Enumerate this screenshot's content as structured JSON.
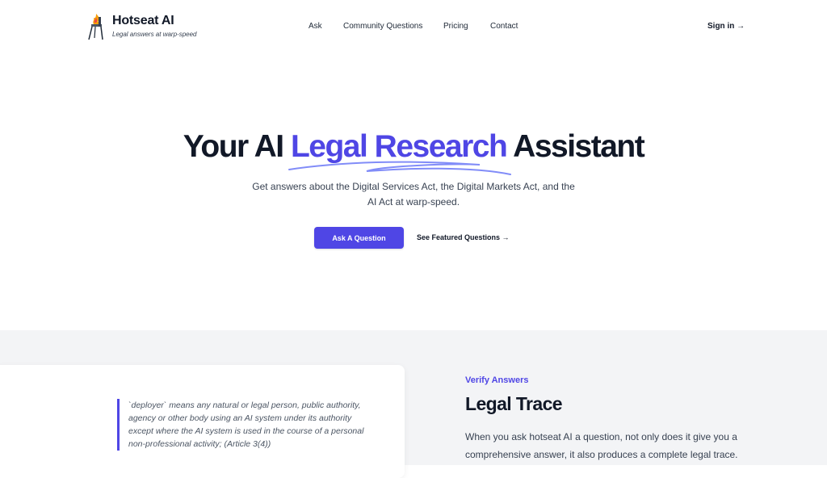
{
  "brand": {
    "name": "Hotseat AI",
    "tagline": "Legal answers at warp-speed"
  },
  "nav": {
    "items": [
      "Ask",
      "Community Questions",
      "Pricing",
      "Contact"
    ],
    "signin": "Sign in →"
  },
  "hero": {
    "title_pre": "Your AI ",
    "title_accent": "Legal Research",
    "title_post": " Assistant",
    "subtitle": "Get answers about the Digital Services Act, the Digital Markets Act, and the AI Act at warp-speed.",
    "primary_button": "Ask A Question",
    "secondary_link": "See Featured Questions →"
  },
  "feature": {
    "quote": "`deployer` means any natural or legal person, public authority, agency or other body using an AI system under its authority except where the AI system is used in the course of a personal non-professional activity; (Article 3(4))",
    "eyebrow": "Verify Answers",
    "title": "Legal Trace",
    "body": "When you ask hotseat AI a question, not only does it give you a comprehensive answer, it also produces a complete legal trace."
  },
  "colors": {
    "accent": "#4f46e5",
    "section_bg": "#f3f4f6",
    "text": "#111827"
  },
  "icons": {
    "logo": "chair-on-fire-icon"
  }
}
